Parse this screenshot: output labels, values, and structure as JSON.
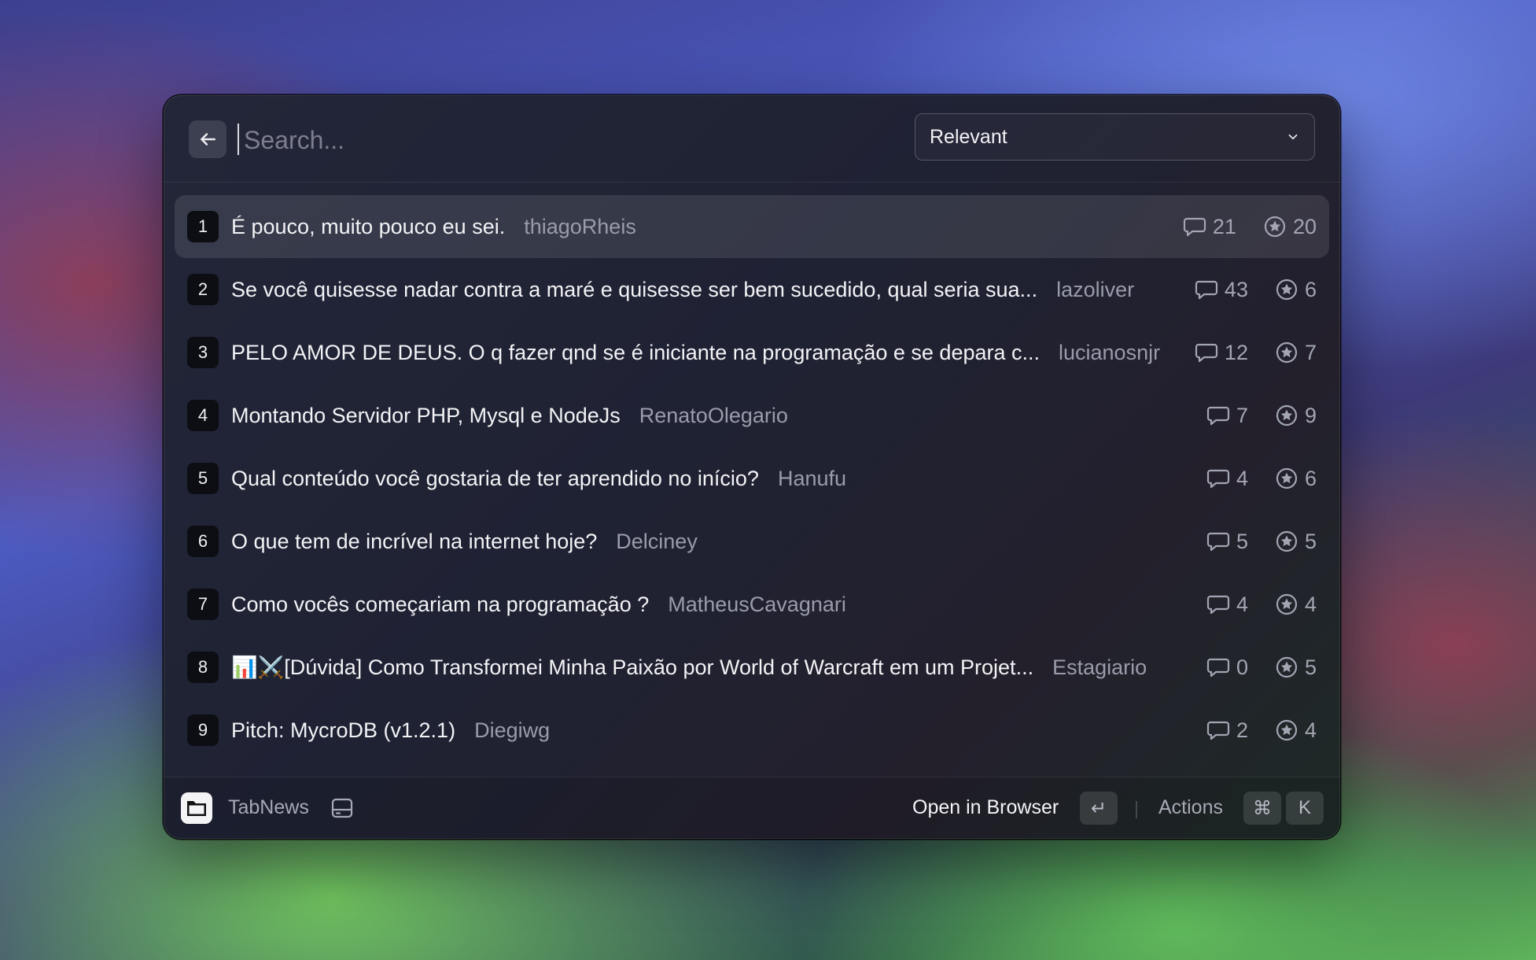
{
  "search": {
    "placeholder": "Search..."
  },
  "filter": {
    "selected": "Relevant"
  },
  "items": [
    {
      "rank": "1",
      "title": "É pouco, muito pouco eu sei.",
      "author": "thiagoRheis",
      "comments": "21",
      "tabcoins": "20"
    },
    {
      "rank": "2",
      "title": "Se você quisesse nadar contra a maré e quisesse ser bem sucedido, qual seria sua...",
      "author": "lazoliver",
      "comments": "43",
      "tabcoins": "6"
    },
    {
      "rank": "3",
      "title": "PELO AMOR DE DEUS. O q fazer qnd se é iniciante na programação e se depara c...",
      "author": "lucianosnjr",
      "comments": "12",
      "tabcoins": "7"
    },
    {
      "rank": "4",
      "title": "Montando Servidor PHP, Mysql e NodeJs",
      "author": "RenatoOlegario",
      "comments": "7",
      "tabcoins": "9"
    },
    {
      "rank": "5",
      "title": "Qual conteúdo você gostaria de ter aprendido no início?",
      "author": "Hanufu",
      "comments": "4",
      "tabcoins": "6"
    },
    {
      "rank": "6",
      "title": "O que tem de incrível na internet hoje?",
      "author": "Delciney",
      "comments": "5",
      "tabcoins": "5"
    },
    {
      "rank": "7",
      "title": "Como vocês começariam na programação ?",
      "author": "MatheusCavagnari",
      "comments": "4",
      "tabcoins": "4"
    },
    {
      "rank": "8",
      "title": "📊⚔️[Dúvida] Como Transformei Minha Paixão por World of Warcraft em um Projet...",
      "author": "Estagiario",
      "comments": "0",
      "tabcoins": "5"
    },
    {
      "rank": "9",
      "title": "Pitch: MycroDB (v1.2.1)",
      "author": "Diegiwg",
      "comments": "2",
      "tabcoins": "4"
    }
  ],
  "footer": {
    "app_name": "TabNews",
    "primary_action": "Open in Browser",
    "primary_key": "↵",
    "actions_label": "Actions",
    "actions_keys": [
      "⌘",
      "K"
    ]
  },
  "icons": {
    "back": "arrow-left-icon",
    "dropdown": "chevron-down-icon",
    "comments": "speech-bubble-icon",
    "tabcoins": "star-coin-icon",
    "app": "folder-icon",
    "storage": "hard-drive-icon"
  }
}
